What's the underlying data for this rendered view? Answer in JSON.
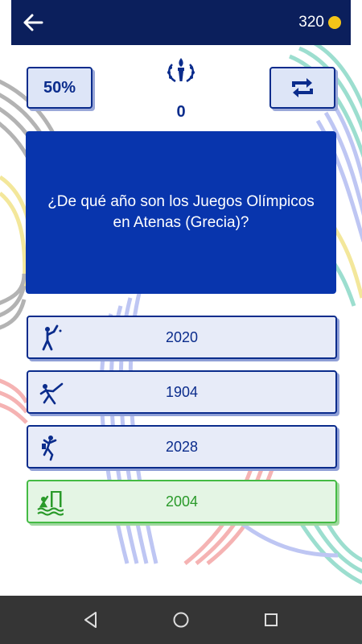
{
  "topbar": {
    "coins": "320",
    "colors": {
      "bar": "#0b1f5c",
      "coin": "#f5c518"
    },
    "icons": {
      "back": "arrow-left-icon",
      "coin": "coin-icon"
    }
  },
  "lifelines": {
    "fifty_label": "50%",
    "refresh_icon": "repeat-icon"
  },
  "score": {
    "value": "0",
    "icon": "torch-laurel-icon"
  },
  "question": {
    "text": "¿De qué año son los Juegos Olímpicos en Atenas (Grecia)?",
    "color": "#0835ad"
  },
  "answers": [
    {
      "label": "2020",
      "icon": "baseball-icon",
      "state": "normal"
    },
    {
      "label": "1904",
      "icon": "fencing-icon",
      "state": "normal"
    },
    {
      "label": "2028",
      "icon": "climbing-icon",
      "state": "normal"
    },
    {
      "label": "2004",
      "icon": "water-polo-icon",
      "state": "correct"
    }
  ],
  "navigation": {
    "back_icon": "triangle-back-icon",
    "home_icon": "circle-home-icon",
    "recents_icon": "square-recents-icon"
  }
}
